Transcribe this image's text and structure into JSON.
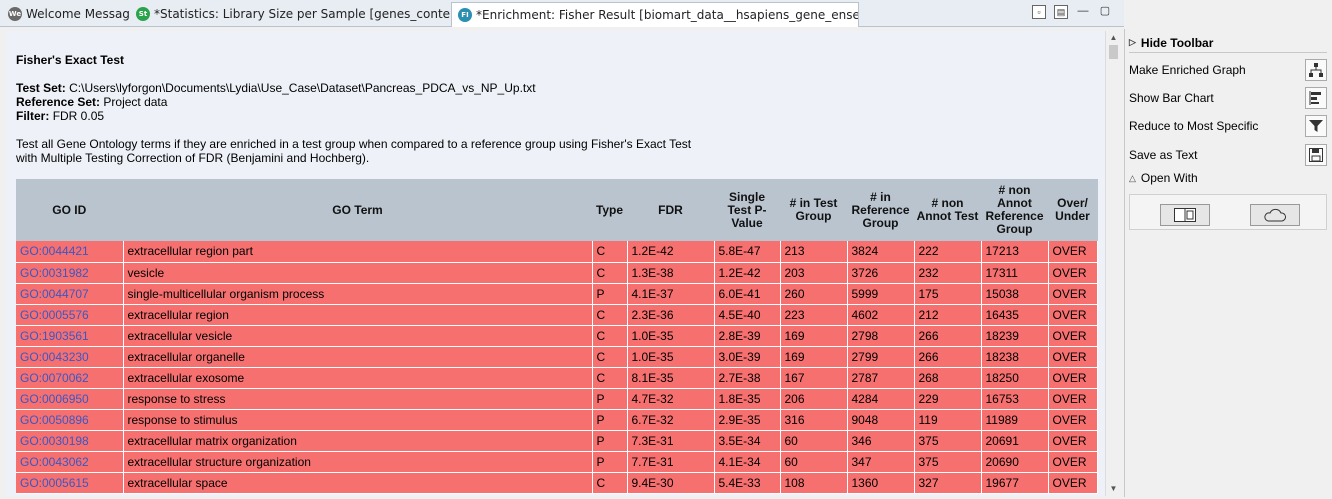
{
  "tabs": [
    {
      "icon_text": "We",
      "icon_color": "#6a6a6a",
      "label": "Welcome Message"
    },
    {
      "icon_text": "St",
      "icon_color": "#2aa34a",
      "label": "*Statistics: Library Size per Sample [genes_conteo_mod]"
    },
    {
      "icon_text": "FI",
      "icon_color": "#2a8fb0",
      "label": "*Enrichment: Fisher Result [biomart_data__hsapiens_gene_ensembl..."
    }
  ],
  "report": {
    "title": "Fisher's Exact Test",
    "test_set_label": "Test Set:",
    "test_set_value": "C:\\Users\\lyforgon\\Documents\\Lydia\\Use_Case\\Dataset\\Pancreas_PDCA_vs_NP_Up.txt",
    "reference_set_label": "Reference Set:",
    "reference_set_value": "Project data",
    "filter_label": "Filter:",
    "filter_value": "FDR 0.05",
    "description_line1": "Test all Gene Ontology terms if they are enriched in a test group when compared to a reference group using Fisher's Exact Test",
    "description_line2": "with Multiple Testing Correction of FDR (Benjamini and Hochberg)."
  },
  "table": {
    "headers": [
      "GO ID",
      "GO Term",
      "Type",
      "FDR",
      "Single Test P-Value",
      "# in Test Group",
      "# in Reference Group",
      "# non Annot Test",
      "# non Annot Reference Group",
      "Over/ Under"
    ],
    "rows": [
      [
        "GO:0044421",
        "extracellular region part",
        "C",
        "1.2E-42",
        "5.8E-47",
        "213",
        "3824",
        "222",
        "17213",
        "OVER"
      ],
      [
        "GO:0031982",
        "vesicle",
        "C",
        "1.3E-38",
        "1.2E-42",
        "203",
        "3726",
        "232",
        "17311",
        "OVER"
      ],
      [
        "GO:0044707",
        "single-multicellular organism process",
        "P",
        "4.1E-37",
        "6.0E-41",
        "260",
        "5999",
        "175",
        "15038",
        "OVER"
      ],
      [
        "GO:0005576",
        "extracellular region",
        "C",
        "2.3E-36",
        "4.5E-40",
        "223",
        "4602",
        "212",
        "16435",
        "OVER"
      ],
      [
        "GO:1903561",
        "extracellular vesicle",
        "C",
        "1.0E-35",
        "2.8E-39",
        "169",
        "2798",
        "266",
        "18239",
        "OVER"
      ],
      [
        "GO:0043230",
        "extracellular organelle",
        "C",
        "1.0E-35",
        "3.0E-39",
        "169",
        "2799",
        "266",
        "18238",
        "OVER"
      ],
      [
        "GO:0070062",
        "extracellular exosome",
        "C",
        "8.1E-35",
        "2.7E-38",
        "167",
        "2787",
        "268",
        "18250",
        "OVER"
      ],
      [
        "GO:0006950",
        "response to stress",
        "P",
        "4.7E-32",
        "1.8E-35",
        "206",
        "4284",
        "229",
        "16753",
        "OVER"
      ],
      [
        "GO:0050896",
        "response to stimulus",
        "P",
        "6.7E-32",
        "2.9E-35",
        "316",
        "9048",
        "119",
        "11989",
        "OVER"
      ],
      [
        "GO:0030198",
        "extracellular matrix organization",
        "P",
        "7.3E-31",
        "3.5E-34",
        "60",
        "346",
        "375",
        "20691",
        "OVER"
      ],
      [
        "GO:0043062",
        "extracellular structure organization",
        "P",
        "7.7E-31",
        "4.1E-34",
        "60",
        "347",
        "375",
        "20690",
        "OVER"
      ],
      [
        "GO:0005615",
        "extracellular space",
        "C",
        "9.4E-30",
        "5.4E-33",
        "108",
        "1360",
        "327",
        "19677",
        "OVER"
      ]
    ]
  },
  "toolbar": {
    "header": "Hide Toolbar",
    "items": [
      {
        "label": "Make Enriched Graph",
        "icon": "graph-icon"
      },
      {
        "label": "Show Bar Chart",
        "icon": "bar-chart-icon"
      },
      {
        "label": "Reduce to Most Specific",
        "icon": "filter-icon"
      },
      {
        "label": "Save as Text",
        "icon": "save-icon"
      }
    ],
    "open_with": "Open With",
    "open_with_buttons": [
      {
        "icon": "split-view-icon"
      },
      {
        "icon": "cloud-icon"
      }
    ]
  },
  "colors": {
    "row_highlight": "#f77070",
    "header_bg": "#b9c4cf",
    "link": "#3a57c4",
    "content_bg": "#eef2f8"
  }
}
